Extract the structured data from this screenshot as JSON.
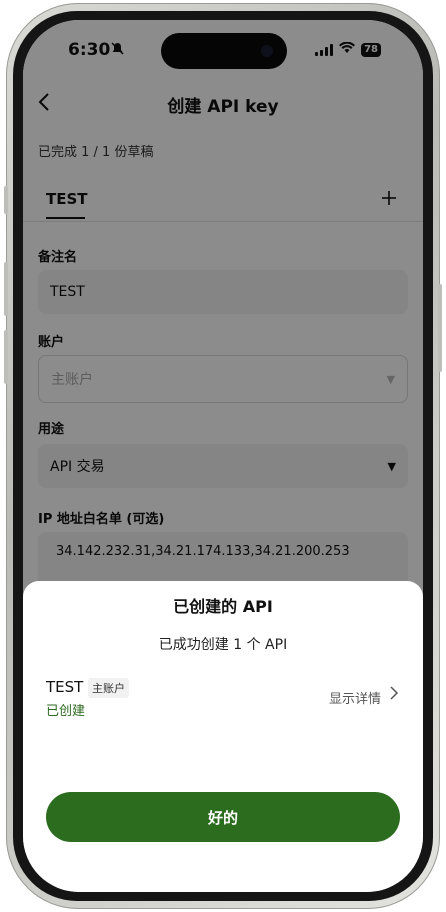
{
  "status_bar": {
    "time": "6:30",
    "battery": "78"
  },
  "header": {
    "title": "创建 API key"
  },
  "progress": "已完成 1 / 1 份草稿",
  "tabs": [
    {
      "label": "TEST"
    }
  ],
  "form": {
    "note": {
      "label": "备注名",
      "value": "TEST"
    },
    "account": {
      "label": "账户",
      "placeholder": "主账户"
    },
    "usage": {
      "label": "用途",
      "value": "API 交易"
    },
    "ip": {
      "label": "IP 地址白名单 (可选)",
      "value": "34.142.232.31,34.21.174.133,34.21.200.253"
    }
  },
  "sheet": {
    "title": "已创建的 API",
    "subtitle": "已成功创建 1 个 API",
    "item": {
      "name": "TEST",
      "badge": "主账户",
      "status": "已创建",
      "details": "显示详情"
    },
    "confirm": "好的"
  },
  "colors": {
    "accent": "#2c6c1f",
    "status_green": "#2d6a1f",
    "overlay": "rgba(0,0,0,0.45)"
  },
  "icons": [
    "back-chevron-icon",
    "add-icon",
    "dropdown-caret-icon",
    "chevron-right-icon",
    "bell-mute-icon",
    "wifi-icon",
    "signal-icon",
    "battery-icon"
  ]
}
